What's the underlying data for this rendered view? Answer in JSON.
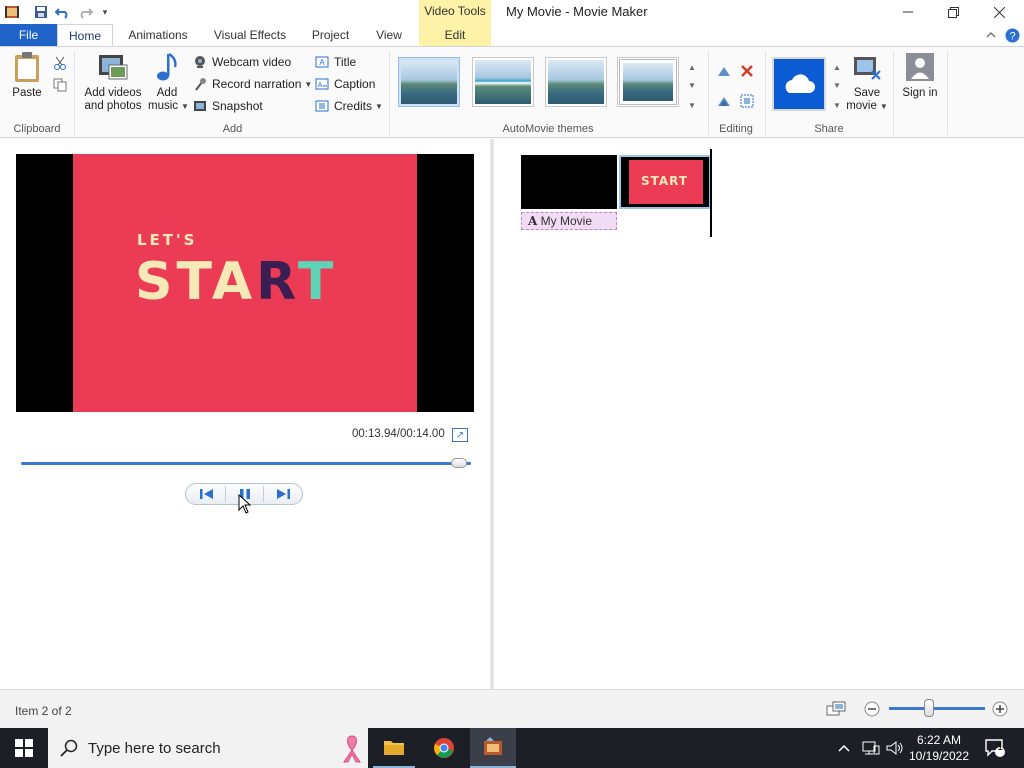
{
  "window": {
    "title": "My Movie - Movie Maker",
    "contextual_group": "Video Tools"
  },
  "tabs": {
    "file": "File",
    "items": [
      "Home",
      "Animations",
      "Visual Effects",
      "Project",
      "View"
    ],
    "edit": "Edit",
    "active": "Home"
  },
  "ribbon": {
    "clipboard": {
      "paste": "Paste",
      "group_label": "Clipboard"
    },
    "add": {
      "add_videos": "Add videos and photos",
      "add_music": "Add music",
      "webcam": "Webcam video",
      "record_narration": "Record narration",
      "snapshot": "Snapshot",
      "title": "Title",
      "caption": "Caption",
      "credits": "Credits",
      "group_label": "Add"
    },
    "themes": {
      "group_label": "AutoMovie themes"
    },
    "editing": {
      "group_label": "Editing"
    },
    "share": {
      "save_movie": "Save movie",
      "group_label": "Share"
    },
    "signin": {
      "label": "Sign in"
    }
  },
  "preview": {
    "slide_top": "LET'S",
    "slide_main": "START",
    "timecode": "00:13.94/00:14.00",
    "seek_progress": 0.99
  },
  "storyboard": {
    "clip2_text": "START",
    "title_clip": "My Movie"
  },
  "status": {
    "item": "Item 2 of 2"
  },
  "taskbar": {
    "search_placeholder": "Type here to search",
    "time": "6:22 AM",
    "date": "10/19/2022",
    "notification_count": "1"
  },
  "colors": {
    "file_tab": "#1f63c6",
    "contextual": "#fdf2a8",
    "slide_bg": "#ec3b55",
    "slide_text": "#f6e9b8",
    "taskbar": "#1c1f26"
  }
}
